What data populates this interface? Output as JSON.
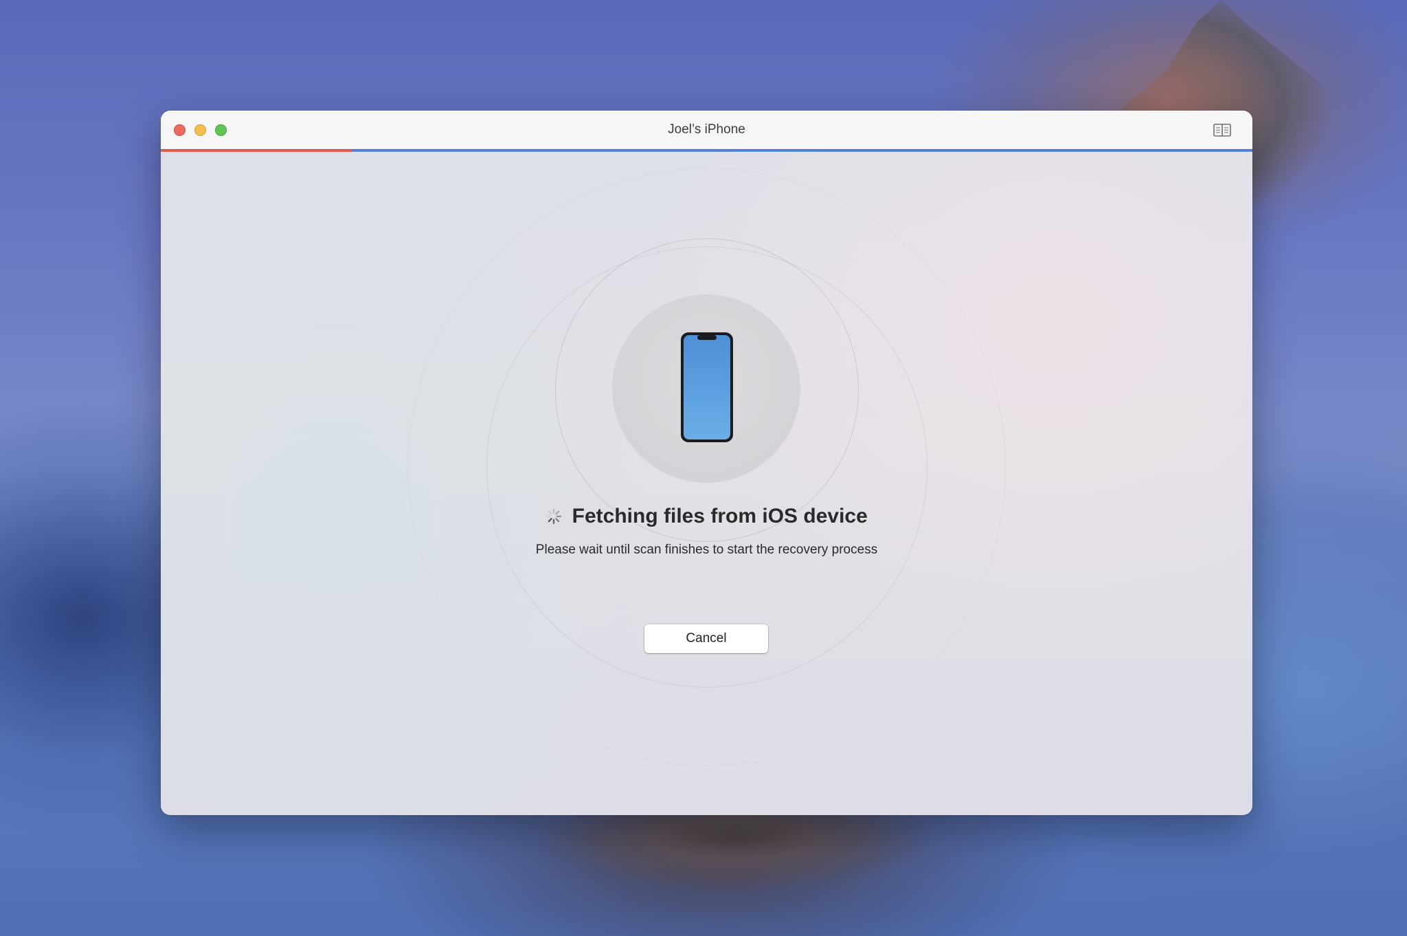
{
  "window": {
    "title": "Joel’s iPhone"
  },
  "progress": {
    "fraction": 0.175,
    "fill_color": "#e05a44",
    "track_color": "#4a82dc"
  },
  "status": {
    "heading": "Fetching files from iOS device",
    "subtitle": "Please wait until scan finishes to start the recovery process"
  },
  "actions": {
    "cancel_label": "Cancel"
  },
  "icons": {
    "titlebar_right": "book-icon",
    "device": "iphone-icon",
    "loading": "spinner-icon"
  },
  "colors": {
    "close": "#ed6a5e",
    "minimize": "#f4bf4f",
    "maximize": "#61c554",
    "phone_screen": "#5a9ee0"
  }
}
